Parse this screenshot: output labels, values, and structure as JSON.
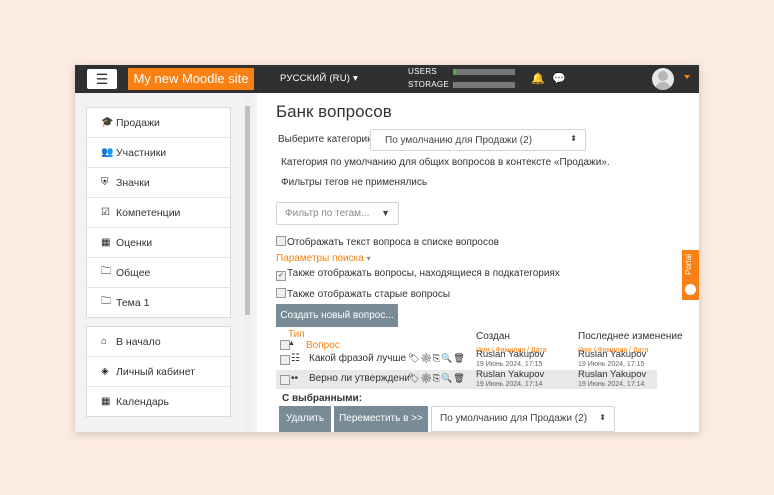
{
  "navbar": {
    "menu_icon": "hamburger-icon",
    "site_name": "My new Moodle site",
    "language": "РУССКИЙ (RU) ▾",
    "users_label": "USERS",
    "storage_label": "STORAGE",
    "users_fill": 0.05,
    "storage_fill": 0.02,
    "colors": {
      "brand": "#f98012",
      "navbar": "#303030"
    }
  },
  "sidebar": {
    "course_items": [
      {
        "icon": "graduation-cap-icon",
        "glyph": "🎓",
        "label": "Продажи"
      },
      {
        "icon": "users-icon",
        "glyph": "👥",
        "label": "Участники"
      },
      {
        "icon": "shield-icon",
        "glyph": "⛨",
        "label": "Значки"
      },
      {
        "icon": "checkbox-icon",
        "glyph": "☑",
        "label": "Компетенции"
      },
      {
        "icon": "table-icon",
        "glyph": "▦",
        "label": "Оценки"
      },
      {
        "icon": "folder-icon",
        "glyph": "🗀",
        "label": "Общее"
      },
      {
        "icon": "folder-icon",
        "glyph": "🗀",
        "label": "Тема 1"
      }
    ],
    "site_items": [
      {
        "icon": "home-icon",
        "glyph": "⌂",
        "label": "В начало"
      },
      {
        "icon": "dashboard-icon",
        "glyph": "◈",
        "label": "Личный кабинет"
      },
      {
        "icon": "calendar-icon",
        "glyph": "▦",
        "label": "Календарь"
      }
    ]
  },
  "main": {
    "title": "Банк вопросов",
    "category_label": "Выберите категорию:",
    "category_value": "По умолчанию для Продажи (2)",
    "category_desc": "Категория по умолчанию для общих вопросов в контексте «Продажи».",
    "tag_note": "Фильтры тегов не применялись",
    "tag_filter_placeholder": "Фильтр по тегам...",
    "show_text": {
      "checked": false,
      "label": "Отображать текст вопроса в списке вопросов"
    },
    "search_params": "Параметры поиска",
    "show_subcats": {
      "checked": true,
      "label": "Также отображать вопросы, находящиеся в подкатегориях"
    },
    "show_old": {
      "checked": false,
      "label": "Также отображать старые вопросы"
    },
    "create_button": "Создать новый вопрос...",
    "table": {
      "col_type": "Тип",
      "col_question": "Вопрос",
      "col_created": "Создан",
      "col_modified": "Последнее изменение",
      "sub_created": "Имя / Фамилия / Дата",
      "sub_modified": "Имя / Фамилия / Дата",
      "rows": [
        {
          "type_icon": "multichoice-icon",
          "type_glyph": "☷",
          "question": "Какой фразой лучше з:",
          "created_by": "Ruslan Yakupov",
          "created_date": "19 Июнь 2024, 17:15",
          "modified_by": "Ruslan Yakupov",
          "modified_date": "19 Июнь 2024, 17:15"
        },
        {
          "type_icon": "truefalse-icon",
          "type_glyph": "••",
          "question": "Верно ли утверждение",
          "created_by": "Ruslan Yakupov",
          "created_date": "19 Июнь 2024, 17:14",
          "modified_by": "Ruslan Yakupov",
          "modified_date": "19 Июнь 2024, 17:14"
        }
      ]
    },
    "with_selected": "С выбранными:",
    "delete_button": "Удалить",
    "move_button": "Переместить в >>",
    "move_target": "По умолчанию для Продажи (2)"
  },
  "portal_tab": "Portal"
}
